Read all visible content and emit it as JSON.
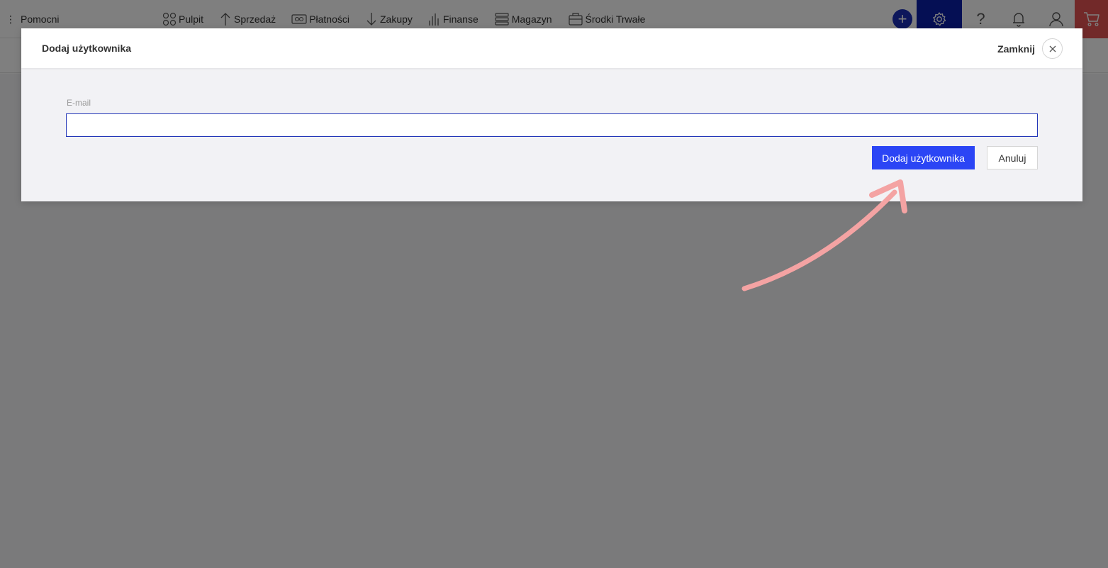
{
  "topbar": {
    "brand": "Pomocni",
    "nav": [
      {
        "label": "Pulpit",
        "icon": "grid-icon"
      },
      {
        "label": "Sprzedaż",
        "icon": "arrow-up-icon"
      },
      {
        "label": "Płatności",
        "icon": "money-icon"
      },
      {
        "label": "Zakupy",
        "icon": "arrow-down-icon"
      },
      {
        "label": "Finanse",
        "icon": "bar-chart-icon"
      },
      {
        "label": "Magazyn",
        "icon": "layers-icon"
      },
      {
        "label": "Środki Trwałe",
        "icon": "briefcase-icon"
      }
    ],
    "tools": [
      "plus-icon",
      "gear-icon",
      "help-icon",
      "bell-icon",
      "user-icon",
      "cart-icon"
    ],
    "colors": {
      "plus": "#1b2fb7",
      "settings": "#0a1fa8",
      "cart": "#e45353"
    }
  },
  "modal": {
    "title": "Dodaj użytkownika",
    "close_label": "Zamknij",
    "email_label": "E-mail",
    "email_value": "",
    "primary_button": "Dodaj użytkownika",
    "secondary_button": "Anuluj",
    "colors": {
      "primary": "#2b45f5",
      "input_border": "#2336b8",
      "annotation_arrow": "#f4a0a0"
    }
  }
}
